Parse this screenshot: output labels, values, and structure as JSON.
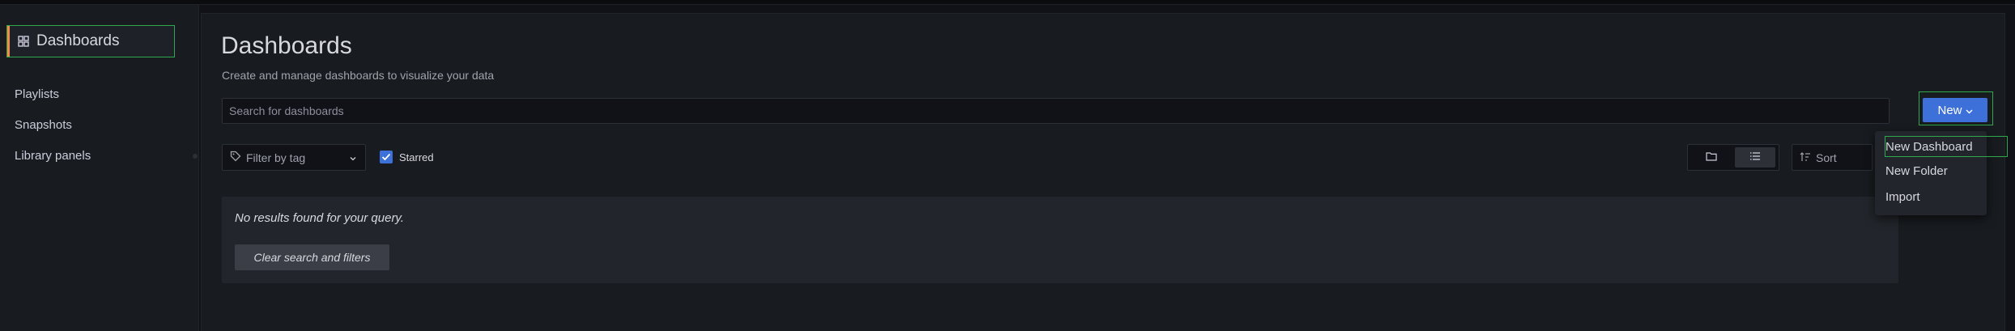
{
  "sidebar": {
    "active": {
      "label": "Dashboards",
      "icon": "grid-icon"
    },
    "items": [
      {
        "label": "Playlists"
      },
      {
        "label": "Snapshots"
      },
      {
        "label": "Library panels"
      }
    ]
  },
  "main": {
    "title": "Dashboards",
    "subtitle": "Create and manage dashboards to visualize your data",
    "search": {
      "placeholder": "Search for dashboards",
      "value": ""
    },
    "new_button": {
      "label": "New",
      "icon": "chevron-down-icon"
    },
    "filter": {
      "placeholder": "Filter by tag",
      "icon": "tag-icon"
    },
    "starred": {
      "label": "Starred",
      "checked": true
    },
    "view_toggle": {
      "options": [
        "folder-view",
        "list-view"
      ],
      "selected": "list-view"
    },
    "sort": {
      "label": "Sort",
      "icon": "sort-icon"
    },
    "results": {
      "empty_message": "No results found for your query.",
      "clear_label": "Clear search and filters"
    }
  },
  "new_menu": {
    "items": [
      {
        "label": "New Dashboard"
      },
      {
        "label": "New Folder"
      },
      {
        "label": "Import"
      }
    ]
  },
  "colors": {
    "accent": "#3d71d9",
    "active_bar": "#f5894a",
    "highlight_outline": "#2ea84a",
    "background": "#111217",
    "panel": "#181b1f"
  }
}
